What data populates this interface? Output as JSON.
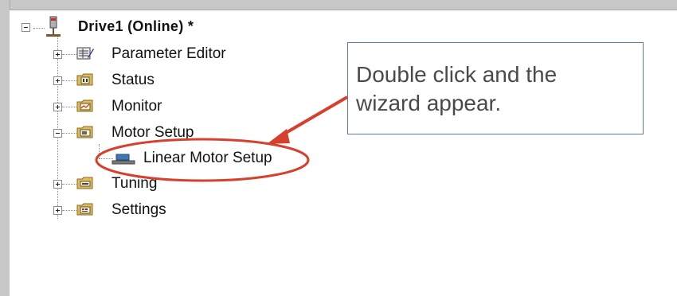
{
  "tree": {
    "root": {
      "label": "Drive1 (Online) *",
      "icon": "drive-icon",
      "expanded": true
    },
    "items": [
      {
        "label": "Parameter Editor",
        "icon": "parameter-editor-icon",
        "expander": "plus"
      },
      {
        "label": "Status",
        "icon": "status-folder-icon",
        "expander": "plus"
      },
      {
        "label": "Monitor",
        "icon": "monitor-folder-icon",
        "expander": "plus"
      },
      {
        "label": "Motor Setup",
        "icon": "motor-setup-folder-icon",
        "expander": "minus",
        "children": [
          {
            "label": "Linear Motor Setup",
            "icon": "linear-motor-icon"
          }
        ]
      },
      {
        "label": "Tuning",
        "icon": "tuning-folder-icon",
        "expander": "plus"
      },
      {
        "label": "Settings",
        "icon": "settings-folder-icon",
        "expander": "plus"
      }
    ]
  },
  "callout": {
    "line1": "Double click and the",
    "line2": "wizard appear."
  },
  "colors": {
    "annotation_red": "#d6412e",
    "callout_border": "#5b78b0",
    "folder": "#d8b24a"
  }
}
